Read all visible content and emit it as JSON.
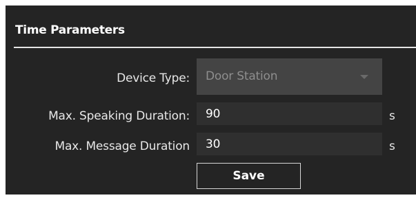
{
  "section": {
    "title": "Time Parameters"
  },
  "form": {
    "device_type": {
      "label": "Device Type:",
      "value": "Door Station"
    },
    "max_speaking_duration": {
      "label": "Max. Speaking Duration:",
      "value": "90",
      "unit": "s"
    },
    "max_message_duration": {
      "label": "Max. Message Duration",
      "value": "30",
      "unit": "s"
    },
    "save_label": "Save"
  },
  "colors": {
    "panel_background": "#242424",
    "input_background": "#2f2f2f",
    "select_background": "#444444",
    "disabled_text": "#8e8e8e",
    "text": "#e8e8e8"
  },
  "icons": {
    "select_caret": "chevron-down-icon"
  }
}
